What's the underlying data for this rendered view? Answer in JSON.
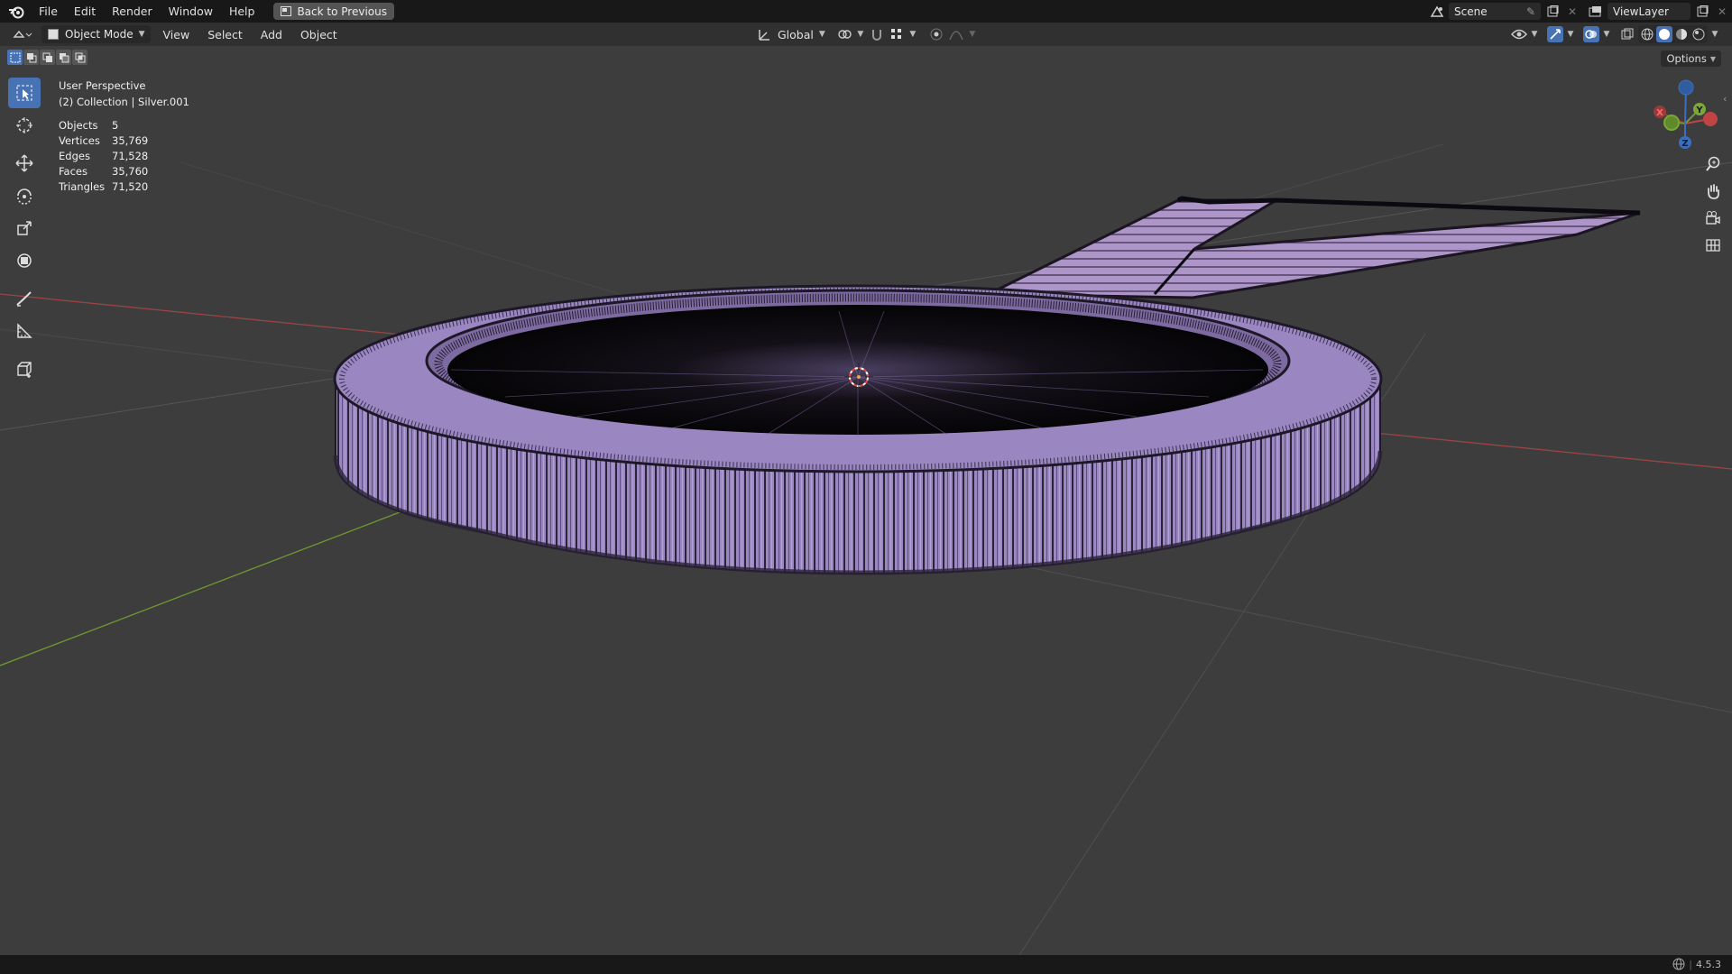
{
  "menu": {
    "items": [
      "File",
      "Edit",
      "Render",
      "Window",
      "Help"
    ],
    "back_button": "Back to Previous"
  },
  "topright": {
    "scene": "Scene",
    "view_layer": "ViewLayer"
  },
  "header": {
    "mode": "Object Mode",
    "view": "View",
    "select": "Select",
    "add": "Add",
    "object": "Object",
    "transform_orientation": "Global",
    "options": "Options"
  },
  "overlay": {
    "perspective": "User Perspective",
    "collection": "(2) Collection | Silver.001",
    "stats": [
      {
        "label": "Objects",
        "value": "5"
      },
      {
        "label": "Vertices",
        "value": "35,769"
      },
      {
        "label": "Edges",
        "value": "71,528"
      },
      {
        "label": "Faces",
        "value": "35,760"
      },
      {
        "label": "Triangles",
        "value": "71,520"
      }
    ]
  },
  "gizmo": {
    "x": "X",
    "y": "Y",
    "z": "Z"
  },
  "status": {
    "version": "4.5.3"
  },
  "colors": {
    "accent": "#4772b3",
    "mesh": "#9a84bf",
    "x_axis": "#c04040",
    "y_axis": "#6f9a2f"
  }
}
